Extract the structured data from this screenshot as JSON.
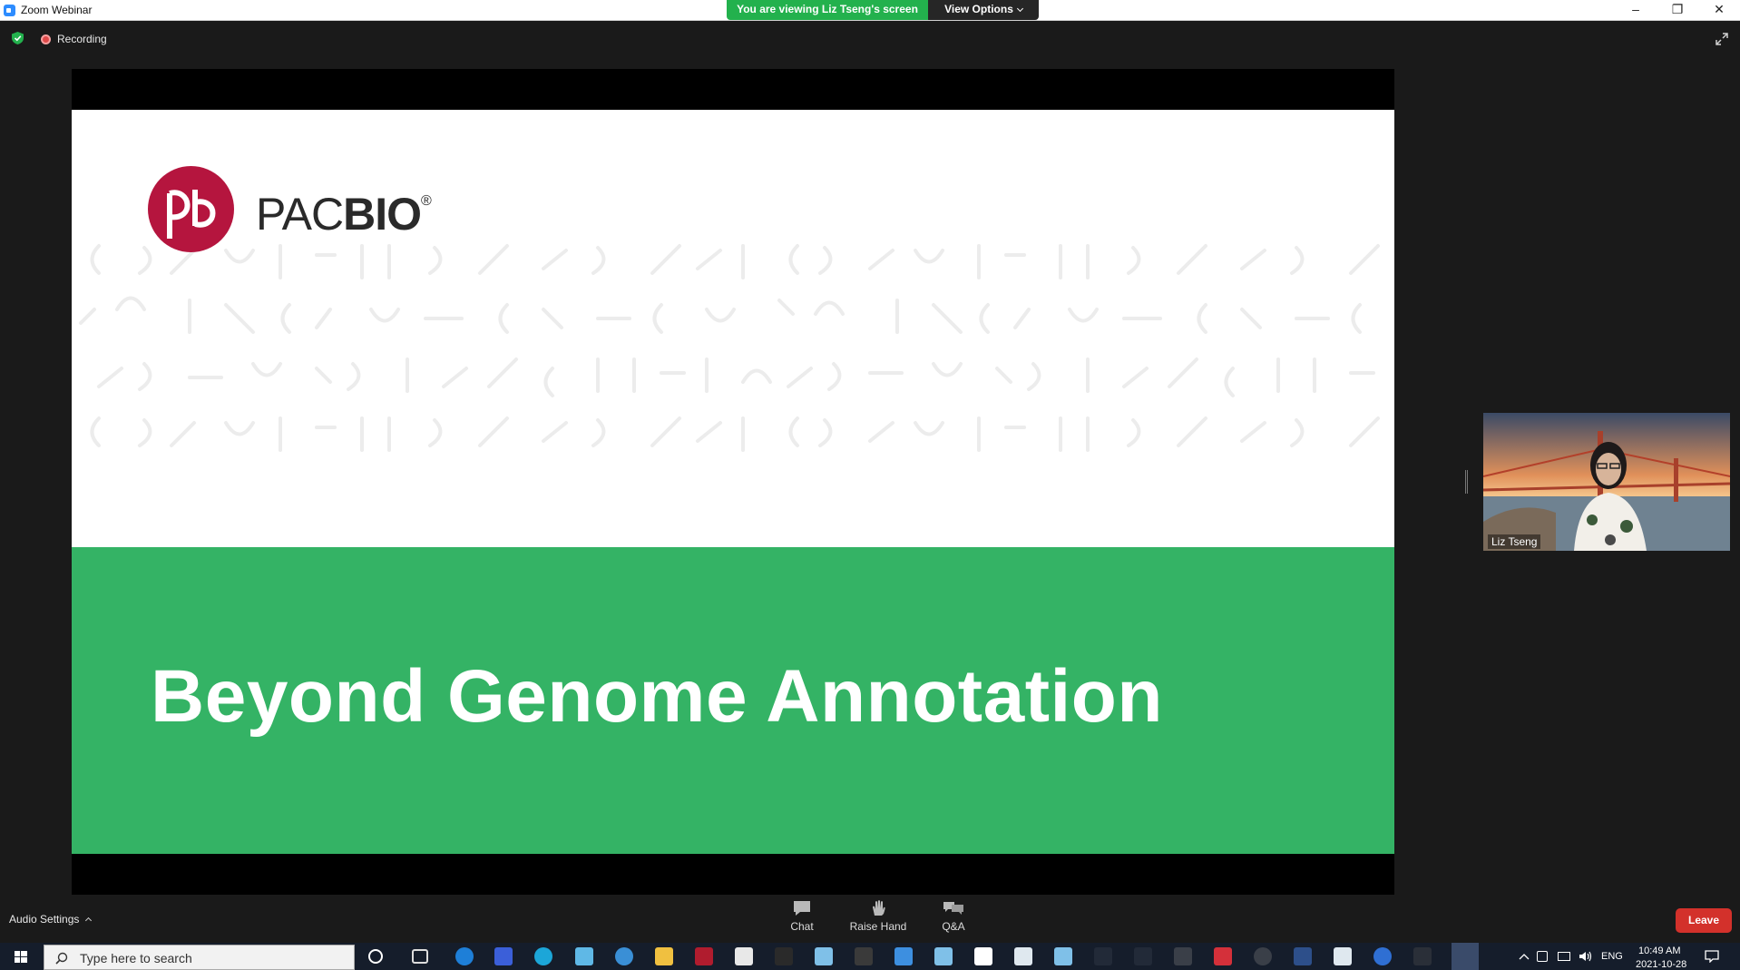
{
  "window": {
    "title": "Zoom Webinar",
    "share_banner": "You are viewing Liz Tseng's screen",
    "view_options": "View Options",
    "minimize": "–",
    "restore": "❐",
    "close": "✕"
  },
  "meeting": {
    "recording_label": "Recording"
  },
  "slide": {
    "brand_thin": "PAC",
    "brand_bold": "BIO",
    "brand_reg": "®",
    "title": "Beyond Genome Annotation",
    "colors": {
      "green": "#34b365",
      "logo_red": "#b5153e"
    }
  },
  "video": {
    "participant_name": "Liz Tseng"
  },
  "controls": {
    "audio_settings": "Audio Settings",
    "chat": "Chat",
    "raise_hand": "Raise Hand",
    "qa": "Q&A",
    "leave": "Leave"
  },
  "taskbar": {
    "search_placeholder": "Type here to search",
    "language": "ENG",
    "time": "10:49 AM",
    "date": "2021-10-28"
  }
}
